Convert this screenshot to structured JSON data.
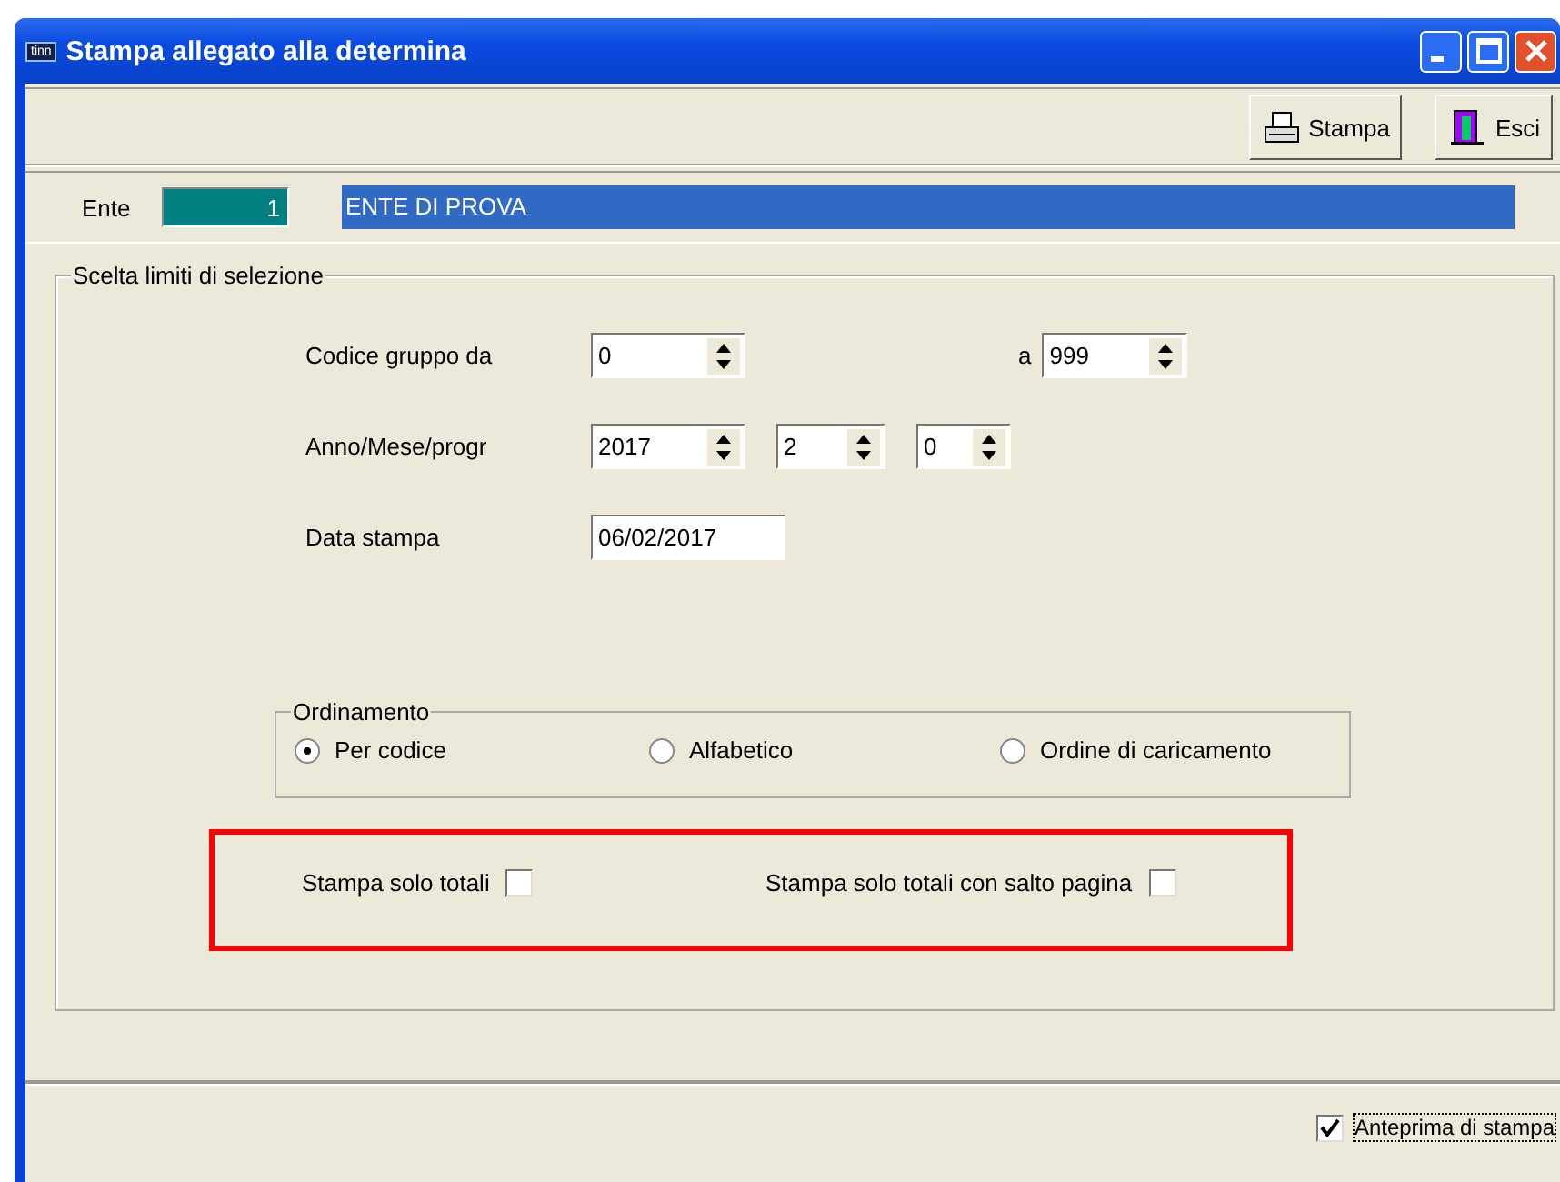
{
  "window": {
    "title": "Stampa allegato alla determina",
    "icon_text": "tinn"
  },
  "toolbar": [
    {
      "label": "Stampa",
      "kind": "print"
    },
    {
      "label": "Esci",
      "kind": "exit"
    }
  ],
  "ente": {
    "label": "Ente",
    "code": "1",
    "name": "ENTE DI PROVA"
  },
  "selection": {
    "title": "Scelta limiti di selezione",
    "codice": {
      "label": "Codice gruppo da",
      "from": "0",
      "to_label": "a",
      "to": "999"
    },
    "anno": {
      "label": "Anno/Mese/progr",
      "values": [
        "2017",
        "2",
        "0"
      ]
    },
    "data": {
      "label": "Data stampa",
      "value": "06/02/2017"
    },
    "ordinamento": {
      "title": "Ordinamento",
      "options": [
        {
          "label": "Per codice",
          "selected": true
        },
        {
          "label": "Alfabetico",
          "selected": false
        },
        {
          "label": "Ordine di caricamento",
          "selected": false
        }
      ]
    },
    "totals": [
      {
        "label": "Stampa solo totali",
        "checked": false
      },
      {
        "label": "Stampa solo totali con salto pagina",
        "checked": false
      }
    ]
  },
  "preview": {
    "label": "Anteprima di stampa",
    "checked": true
  }
}
